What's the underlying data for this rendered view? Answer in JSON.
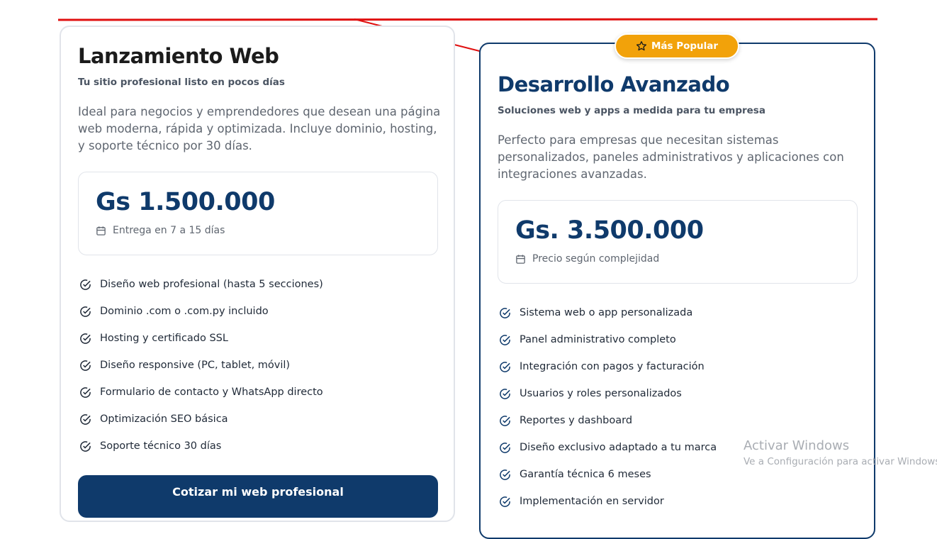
{
  "plans": [
    {
      "title": "Lanzamiento Web",
      "subtitle": "Tu sitio profesional listo en pocos días",
      "description": "Ideal para negocios y emprendedores que desean una página web moderna, rápida y optimizada. Incluye dominio, hosting, y soporte técnico por 30 días.",
      "price": "Gs 1.500.000",
      "delivery": "Entrega en 7 a 15 días",
      "features": [
        "Diseño web profesional (hasta 5 secciones)",
        "Dominio .com o .com.py incluido",
        "Hosting y certificado SSL",
        "Diseño responsive (PC, tablet, móvil)",
        "Formulario de contacto y WhatsApp directo",
        "Optimización SEO básica",
        "Soporte técnico 30 días"
      ],
      "cta_label": "Cotizar mi web profesional"
    },
    {
      "badge_label": "Más Popular",
      "badge_icon": "star-icon",
      "title": "Desarrollo Avanzado",
      "subtitle": "Soluciones web y apps a medida para tu empresa",
      "description": "Perfecto para empresas que necesitan sistemas personalizados, paneles administrativos y aplicaciones con integraciones avanzadas.",
      "price": "Gs. 3.500.000",
      "delivery": "Precio según complejidad",
      "features": [
        "Sistema web o app personalizada",
        "Panel administrativo completo",
        "Integración con pagos y facturación",
        "Usuarios y roles personalizados",
        "Reportes y dashboard",
        "Diseño exclusivo adaptado a tu marca",
        "Garantía técnica 6 meses",
        "Implementación en servidor"
      ]
    }
  ],
  "watermark": {
    "line1": "Activar Windows",
    "line2": "Ve a Configuración para activar Windows"
  },
  "colors": {
    "brand": "#0f3a6b",
    "badge": "#f2a20a",
    "annotation": "#e01010"
  }
}
